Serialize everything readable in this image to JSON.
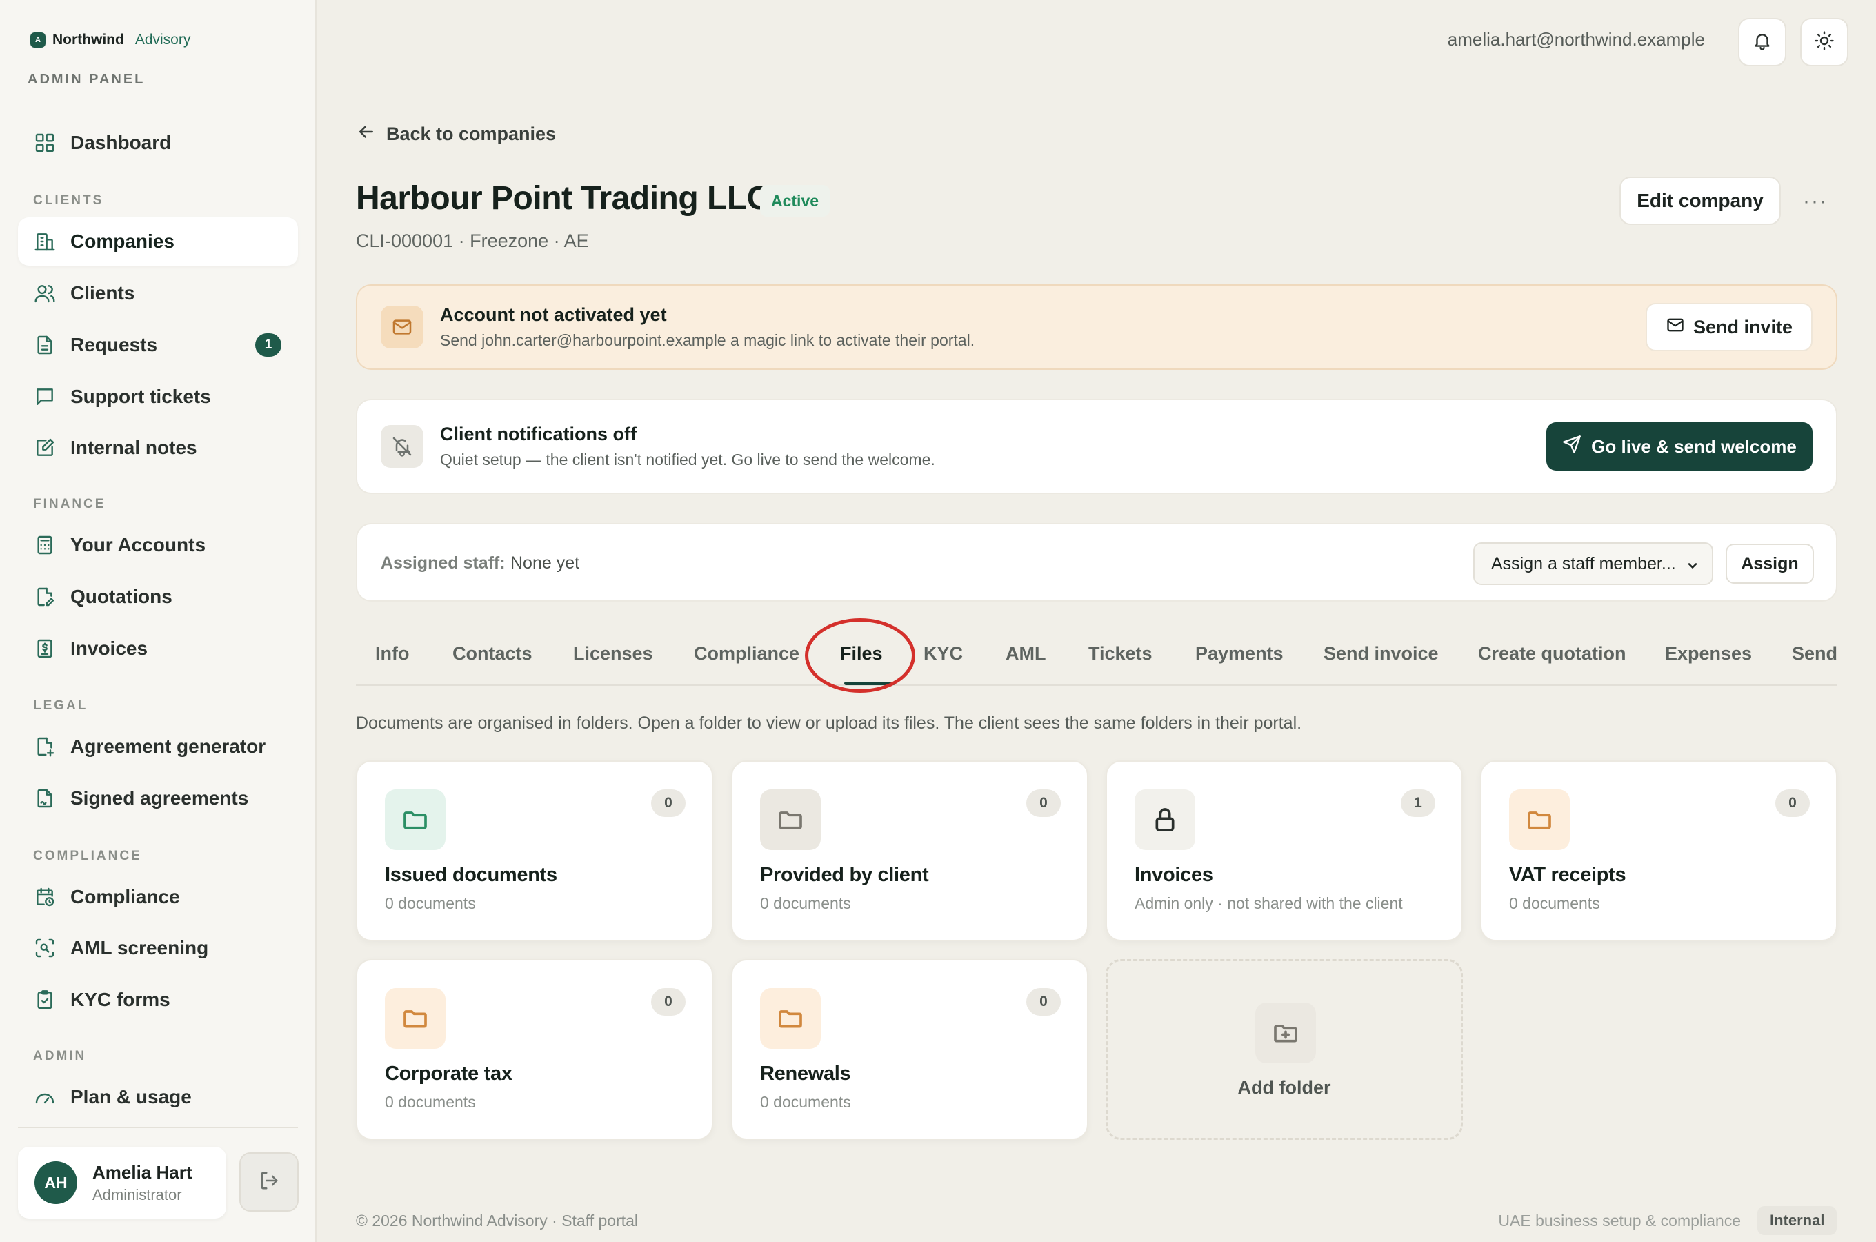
{
  "brand": {
    "mark": "A",
    "name": "Northwind",
    "sub": "Advisory",
    "panel_label": "ADMIN PANEL"
  },
  "sidebar": {
    "dashboard": "Dashboard",
    "sections": {
      "clients": "CLIENTS",
      "finance": "FINANCE",
      "legal": "LEGAL",
      "compliance": "COMPLIANCE",
      "admin": "ADMIN"
    },
    "items": {
      "companies": "Companies",
      "clients": "Clients",
      "requests": "Requests",
      "requests_badge": "1",
      "support_tickets": "Support tickets",
      "internal_notes": "Internal notes",
      "your_accounts": "Your Accounts",
      "quotations": "Quotations",
      "invoices": "Invoices",
      "agreement_generator": "Agreement generator",
      "signed_agreements": "Signed agreements",
      "compliance": "Compliance",
      "aml_screening": "AML screening",
      "kyc_forms": "KYC forms",
      "plan_usage": "Plan & usage"
    },
    "active_item": "Companies",
    "user": {
      "initials": "AH",
      "name": "Amelia Hart",
      "role": "Administrator"
    }
  },
  "topbar": {
    "email": "amelia.hart@northwind.example",
    "icons": [
      "bell-icon",
      "sun-icon"
    ]
  },
  "page": {
    "back_label": "Back to companies",
    "company_name": "Harbour Point Trading LLC",
    "status": "Active",
    "meta": "CLI-000001 · Freezone · AE",
    "edit_label": "Edit company",
    "more_label": "···"
  },
  "banners": {
    "activation": {
      "title": "Account not activated yet",
      "desc": "Send john.carter@harbourpoint.example a magic link to activate their portal.",
      "button": "Send invite"
    },
    "notifications": {
      "title": "Client notifications off",
      "desc": "Quiet setup — the client isn't notified yet. Go live to send the welcome.",
      "button": "Go live & send welcome"
    }
  },
  "staff": {
    "label": "Assigned staff:",
    "value": "None yet",
    "select_placeholder": "Assign a staff member...",
    "assign_label": "Assign"
  },
  "tabs": [
    "Info",
    "Contacts",
    "Licenses",
    "Compliance",
    "Files",
    "KYC",
    "AML",
    "Tickets",
    "Payments",
    "Send invoice",
    "Create quotation",
    "Expenses",
    "Send"
  ],
  "active_tab": "Files",
  "files": {
    "intro": "Documents are organised in folders. Open a folder to view or upload its files. The client sees the same folders in their portal.",
    "folders": [
      {
        "name": "Issued documents",
        "sub": "0 documents",
        "count": "0",
        "color": "#2b8f65"
      },
      {
        "name": "Provided by client",
        "sub": "0 documents",
        "count": "0",
        "color": "#7a776f"
      },
      {
        "name": "Invoices",
        "sub": "Admin only · not shared with the client",
        "count": "1",
        "color": "#2a302d"
      },
      {
        "name": "VAT receipts",
        "sub": "0 documents",
        "count": "0",
        "color": "#d1883e"
      },
      {
        "name": "Corporate tax",
        "sub": "0 documents",
        "count": "0",
        "color": "#d1883e"
      },
      {
        "name": "Renewals",
        "sub": "0 documents",
        "count": "0",
        "color": "#d1883e"
      }
    ],
    "add_label": "Add folder"
  },
  "footer": {
    "left": "© 2026 Northwind Advisory · Staff portal",
    "right": "UAE business setup & compliance",
    "badge": "Internal"
  }
}
